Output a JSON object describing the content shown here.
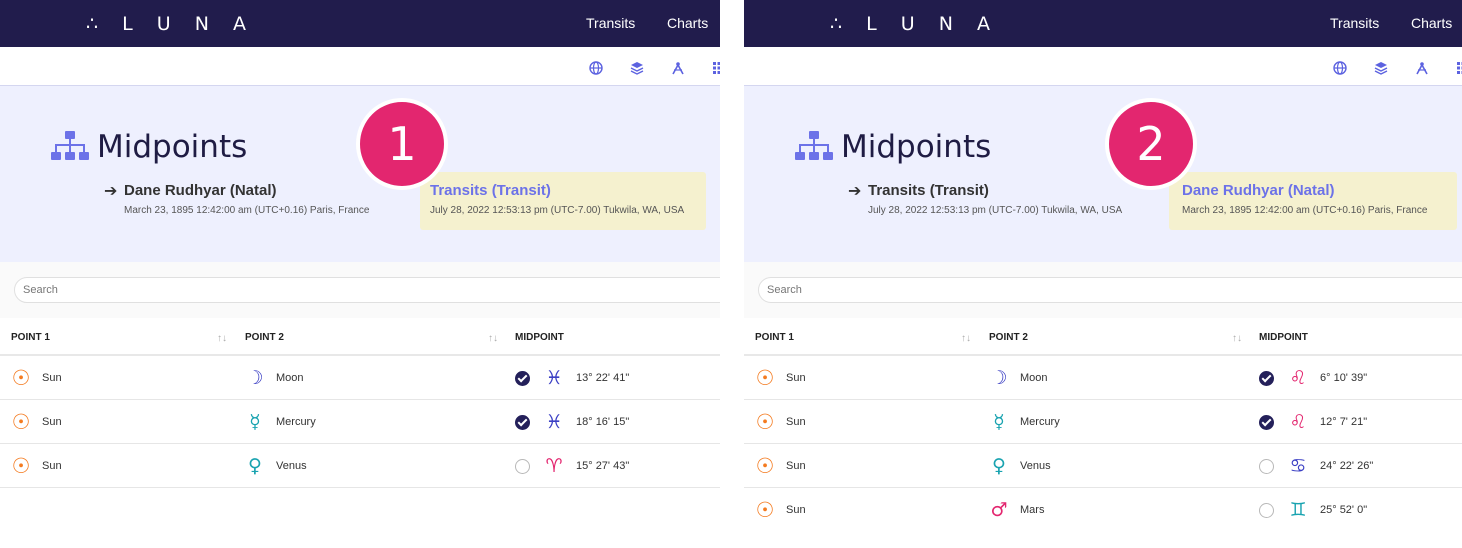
{
  "app": {
    "logo": "∴ L U N A"
  },
  "nav": {
    "transits": "Transits",
    "charts": "Charts"
  },
  "toolbar_icons": [
    "globe-icon",
    "layers-icon",
    "compass-icon",
    "grid-icon"
  ],
  "page": {
    "title": "Midpoints"
  },
  "search": {
    "placeholder": "Search"
  },
  "table": {
    "col1": "POINT 1",
    "col2": "POINT 2",
    "col3": "MIDPOINT",
    "sort_glyph": "↑↓"
  },
  "colors": {
    "nav_bg": "#211c4c",
    "hero_bg": "#eef0fe",
    "badge": "#e3266f",
    "accent": "#6c72e8",
    "highlight": "#f5f1cf"
  },
  "panels": [
    {
      "step": "1",
      "chart_a": {
        "name": "Dane Rudhyar (Natal)",
        "meta": "March 23, 1895 12:42:00 am (UTC+0.16) Paris, France"
      },
      "chart_b": {
        "name": "Transits (Transit)",
        "meta": "July 28, 2022 12:53:13 pm (UTC-7.00) Tukwila, WA, USA"
      },
      "rows": [
        {
          "p1": "Sun",
          "p1_glyph": "☉",
          "p2": "Moon",
          "p2_glyph": "☽",
          "p2_color": "#3b3fc4",
          "checked": true,
          "sign_glyph": "♓",
          "sign_color": "#3b3fc4",
          "degree": "13° 22' 41\""
        },
        {
          "p1": "Sun",
          "p1_glyph": "☉",
          "p2": "Mercury",
          "p2_glyph": "☿",
          "p2_color": "#19a3b0",
          "checked": true,
          "sign_glyph": "♓",
          "sign_color": "#3b3fc4",
          "degree": "18° 16' 15\""
        },
        {
          "p1": "Sun",
          "p1_glyph": "☉",
          "p2": "Venus",
          "p2_glyph": "♀",
          "p2_color": "#19a3b0",
          "checked": false,
          "sign_glyph": "♈",
          "sign_color": "#e3266f",
          "degree": "15° 27' 43\""
        }
      ]
    },
    {
      "step": "2",
      "chart_a": {
        "name": "Transits (Transit)",
        "meta": "July 28, 2022 12:53:13 pm (UTC-7.00) Tukwila, WA, USA"
      },
      "chart_b": {
        "name": "Dane Rudhyar (Natal)",
        "meta": "March 23, 1895 12:42:00 am (UTC+0.16) Paris, France"
      },
      "rows": [
        {
          "p1": "Sun",
          "p1_glyph": "☉",
          "p2": "Moon",
          "p2_glyph": "☽",
          "p2_color": "#3b3fc4",
          "checked": true,
          "sign_glyph": "♌",
          "sign_color": "#e3266f",
          "degree": "6° 10' 39\""
        },
        {
          "p1": "Sun",
          "p1_glyph": "☉",
          "p2": "Mercury",
          "p2_glyph": "☿",
          "p2_color": "#19a3b0",
          "checked": true,
          "sign_glyph": "♌",
          "sign_color": "#e3266f",
          "degree": "12° 7' 21\""
        },
        {
          "p1": "Sun",
          "p1_glyph": "☉",
          "p2": "Venus",
          "p2_glyph": "♀",
          "p2_color": "#19a3b0",
          "checked": false,
          "sign_glyph": "♋",
          "sign_color": "#3b3fc4",
          "degree": "24° 22' 26\""
        },
        {
          "p1": "Sun",
          "p1_glyph": "☉",
          "p2": "Mars",
          "p2_glyph": "♂",
          "p2_color": "#e3266f",
          "checked": false,
          "sign_glyph": "♊",
          "sign_color": "#19a3b0",
          "degree": "25° 52' 0\""
        }
      ]
    }
  ]
}
